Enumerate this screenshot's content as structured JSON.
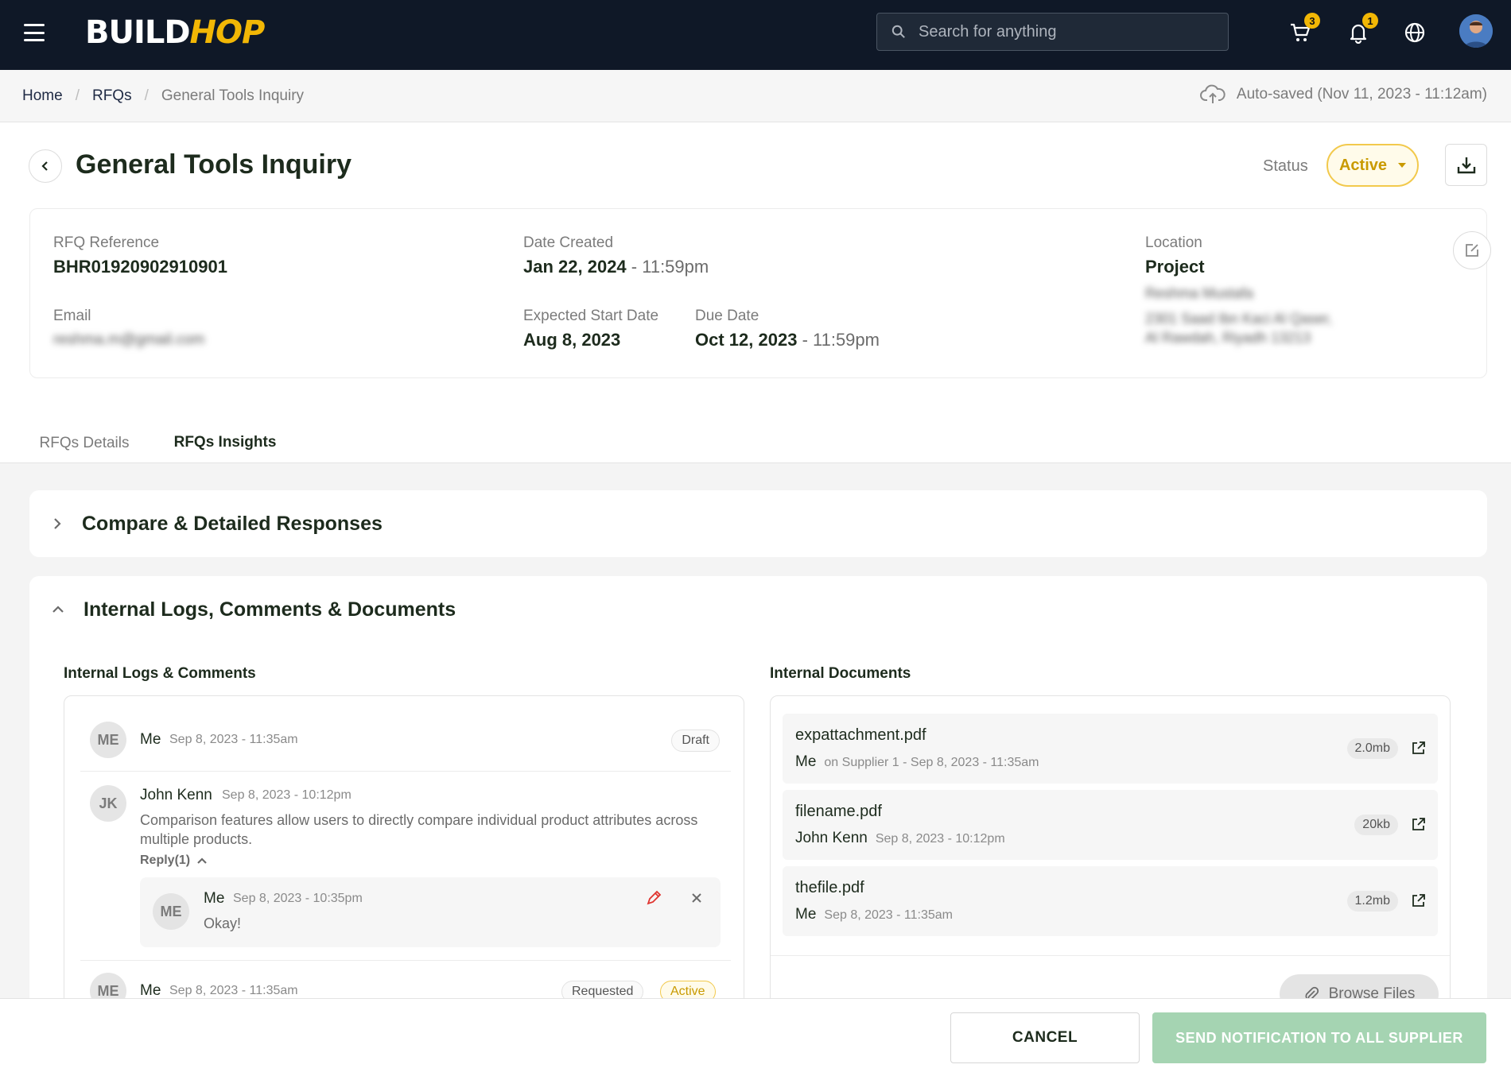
{
  "app": {
    "logo_part1": "BUILD",
    "logo_part2": "HOP",
    "brand_color": "#f2b705",
    "nav_bg": "#0f1827"
  },
  "topbar": {
    "search_placeholder": "Search for anything",
    "cart_badge": "3",
    "notification_badge": "1",
    "icons": [
      "menu-icon",
      "search-icon",
      "cart-icon",
      "bell-icon",
      "globe-icon"
    ]
  },
  "breadcrumb": {
    "items": [
      "Home",
      "RFQs"
    ],
    "current": "General Tools Inquiry"
  },
  "autosave": "Auto-saved (Nov 11, 2023 - 11:12am)",
  "header": {
    "title": "General Tools Inquiry",
    "status_label": "Status",
    "status_value": "Active"
  },
  "info": {
    "rfq_ref_label": "RFQ Reference",
    "rfq_ref_value": "BHR01920902910901",
    "email_label": "Email",
    "email_value": "reshma.m@gmail.com",
    "date_created_label": "Date Created",
    "date_created_value": "Jan 22, 2024",
    "date_created_time": "- 11:59pm",
    "start_date_label": "Expected Start Date",
    "start_date_value": "Aug 8, 2023",
    "due_date_label": "Due Date",
    "due_date_value": "Oct 12, 2023",
    "due_date_time": "- 11:59pm",
    "location_label": "Location",
    "location_value": "Project",
    "location_name": "Reshma Mustafa",
    "location_addr1": "2301 Saad Ibn Kaci Al Qaser,",
    "location_addr2": "Al Rawdah, Riyadh 13213"
  },
  "tabs": [
    {
      "label": "RFQs Details"
    },
    {
      "label": "RFQs Insights"
    }
  ],
  "sections": {
    "compare_title": "Compare & Detailed Responses",
    "logs_title": "Internal Logs, Comments & Documents",
    "logs_subtitle": "Internal Logs & Comments",
    "docs_subtitle": "Internal Documents"
  },
  "comments": [
    {
      "initials": "ME",
      "name": "Me",
      "time": "Sep 8, 2023 - 11:35am",
      "tag": "Draft"
    },
    {
      "initials": "JK",
      "name": "John Kenn",
      "time": "Sep 8, 2023 - 10:12pm",
      "body": "Comparison features allow users to directly compare individual product attributes across multiple products.",
      "reply_toggle": "Reply(1)"
    },
    {
      "initials": "ME",
      "name": "Me",
      "time": "Sep 8, 2023 - 11:35am",
      "tag1": "Requested",
      "tag2": "Active"
    }
  ],
  "reply": {
    "initials": "ME",
    "name": "Me",
    "time": "Sep 8, 2023 - 10:35pm",
    "body": "Okay!"
  },
  "documents": [
    {
      "name": "expattachment.pdf",
      "user": "Me",
      "meta": "on Supplier 1 - Sep 8, 2023 - 11:35am",
      "size": "2.0mb"
    },
    {
      "name": "filename.pdf",
      "user": "John Kenn",
      "meta": "Sep 8, 2023 - 10:12pm",
      "size": "20kb"
    },
    {
      "name": "thefile.pdf",
      "user": "Me",
      "meta": "Sep 8, 2023 - 11:35am",
      "size": "1.2mb"
    }
  ],
  "browse_label": "Browse Files",
  "footer": {
    "cancel_label": "CANCEL",
    "send_label": "SEND NOTIFICATION TO ALL SUPPLIER"
  }
}
